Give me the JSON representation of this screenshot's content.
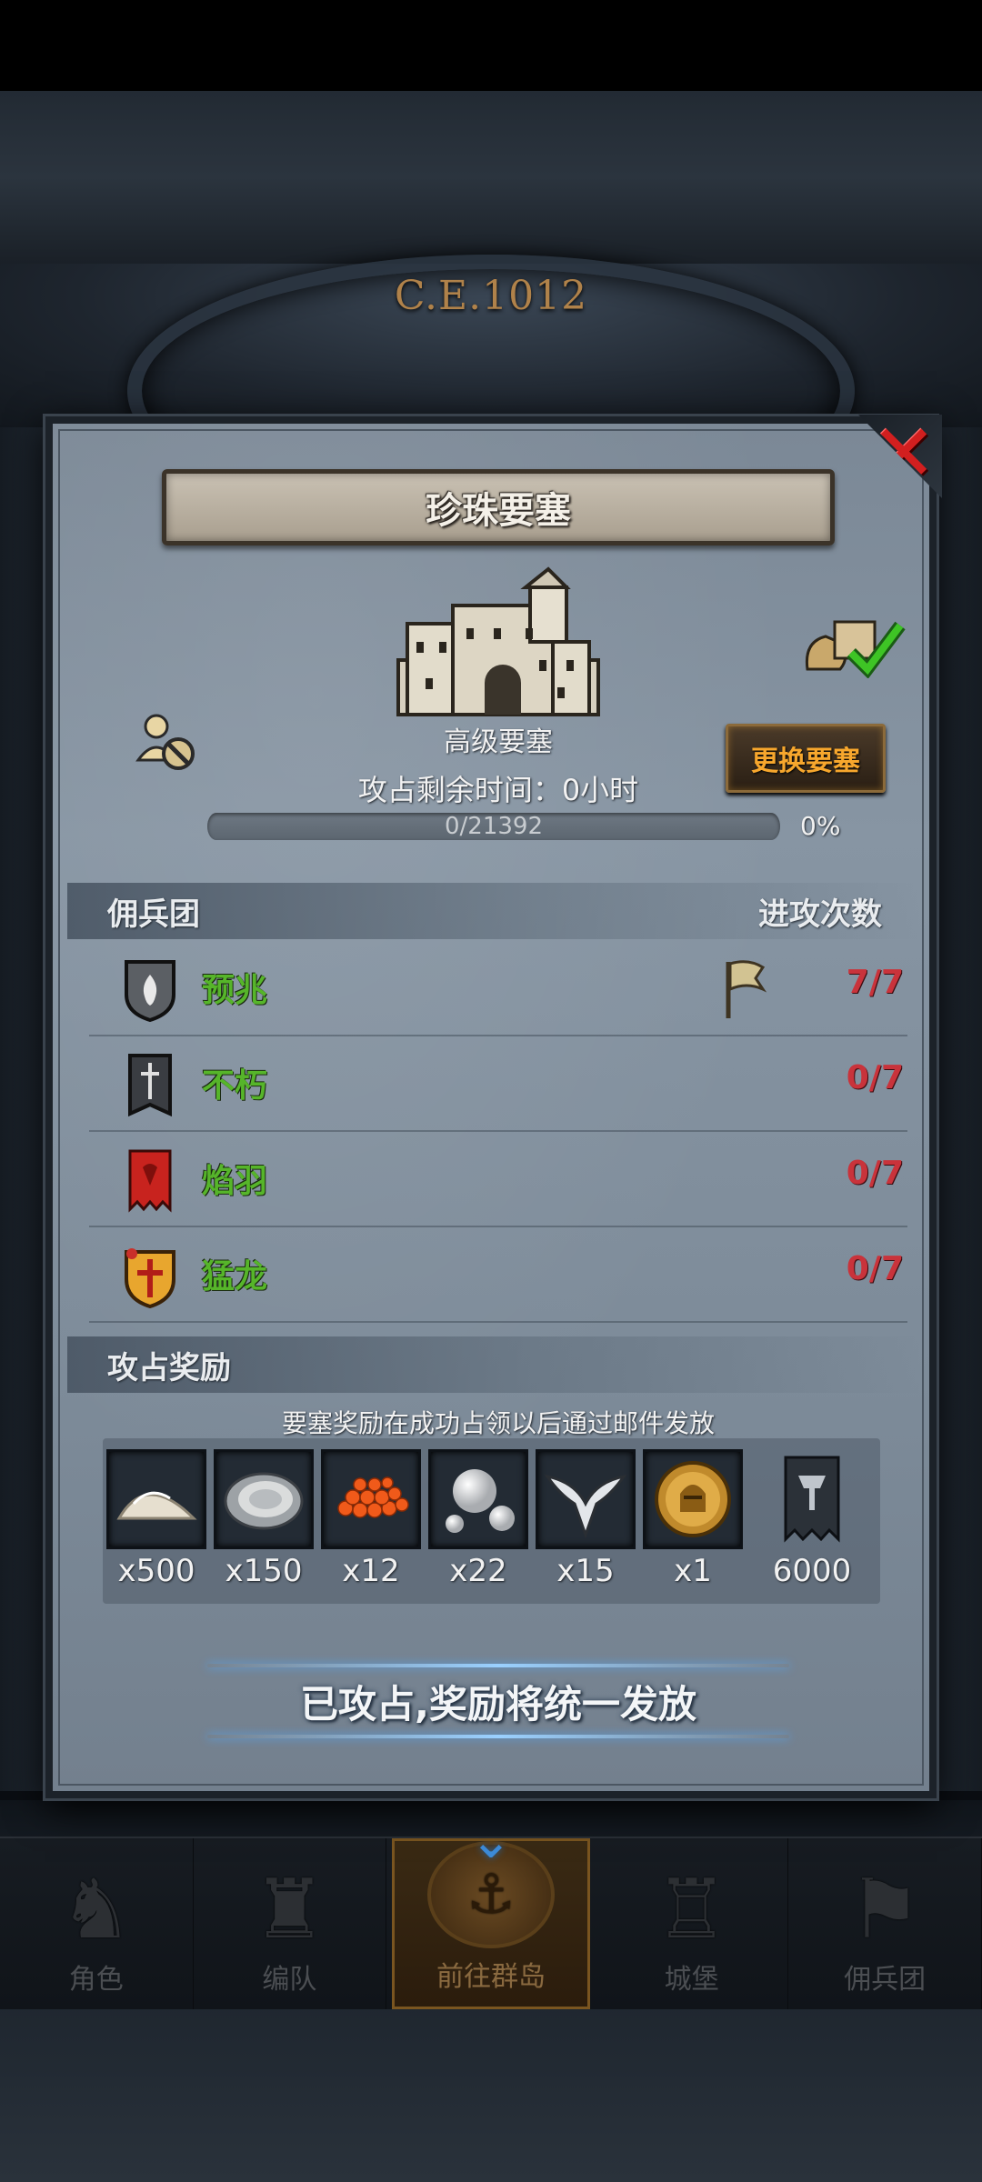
{
  "header": {
    "era_label": "C.E.1012"
  },
  "modal": {
    "title": "珍珠要塞",
    "fortress_type": "高级要塞",
    "remaining_time": "攻占剩余时间：0小时",
    "change_button": "更换要塞",
    "progress": {
      "text": "0/21392",
      "current": 0,
      "total": 21392,
      "percent_label": "0%"
    },
    "mercenaries": {
      "header_left": "佣兵团",
      "header_right": "进攻次数",
      "rows": [
        {
          "name": "预兆",
          "count": "7/7",
          "icon": "flame-shield-icon",
          "flag": true
        },
        {
          "name": "不朽",
          "count": "0/7",
          "icon": "sword-banner-icon",
          "flag": false
        },
        {
          "name": "焰羽",
          "count": "0/7",
          "icon": "red-banner-icon",
          "flag": false
        },
        {
          "name": "猛龙",
          "count": "0/7",
          "icon": "dragon-shield-icon",
          "flag": false
        }
      ]
    },
    "rewards": {
      "header": "攻占奖励",
      "note": "要塞奖励在成功占领以后通过邮件发放",
      "items": [
        {
          "icon": "sand-pile-icon",
          "qty": "x500"
        },
        {
          "icon": "oyster-icon",
          "qty": "x150"
        },
        {
          "icon": "roe-icon",
          "qty": "x12"
        },
        {
          "icon": "pearls-icon",
          "qty": "x22"
        },
        {
          "icon": "winged-emblem-icon",
          "qty": "x15"
        },
        {
          "icon": "knight-coin-icon",
          "qty": "x1"
        },
        {
          "icon": "guild-banner-icon",
          "qty": "6000"
        }
      ]
    },
    "status_text": "已攻占,奖励将统一发放"
  },
  "bottom_nav": [
    {
      "label": "角色",
      "icon": "knight-icon",
      "active": false
    },
    {
      "label": "编队",
      "icon": "formation-icon",
      "active": false
    },
    {
      "label": "前往群岛",
      "icon": "islands-icon",
      "active": true
    },
    {
      "label": "城堡",
      "icon": "castle-icon",
      "active": false
    },
    {
      "label": "佣兵团",
      "icon": "mercenary-icon",
      "active": false
    }
  ],
  "colors": {
    "merc_name": "#56b52a",
    "attack_count": "#c9333b",
    "change_button_text": "#f7a72d",
    "close_x": "#d21f1f"
  }
}
